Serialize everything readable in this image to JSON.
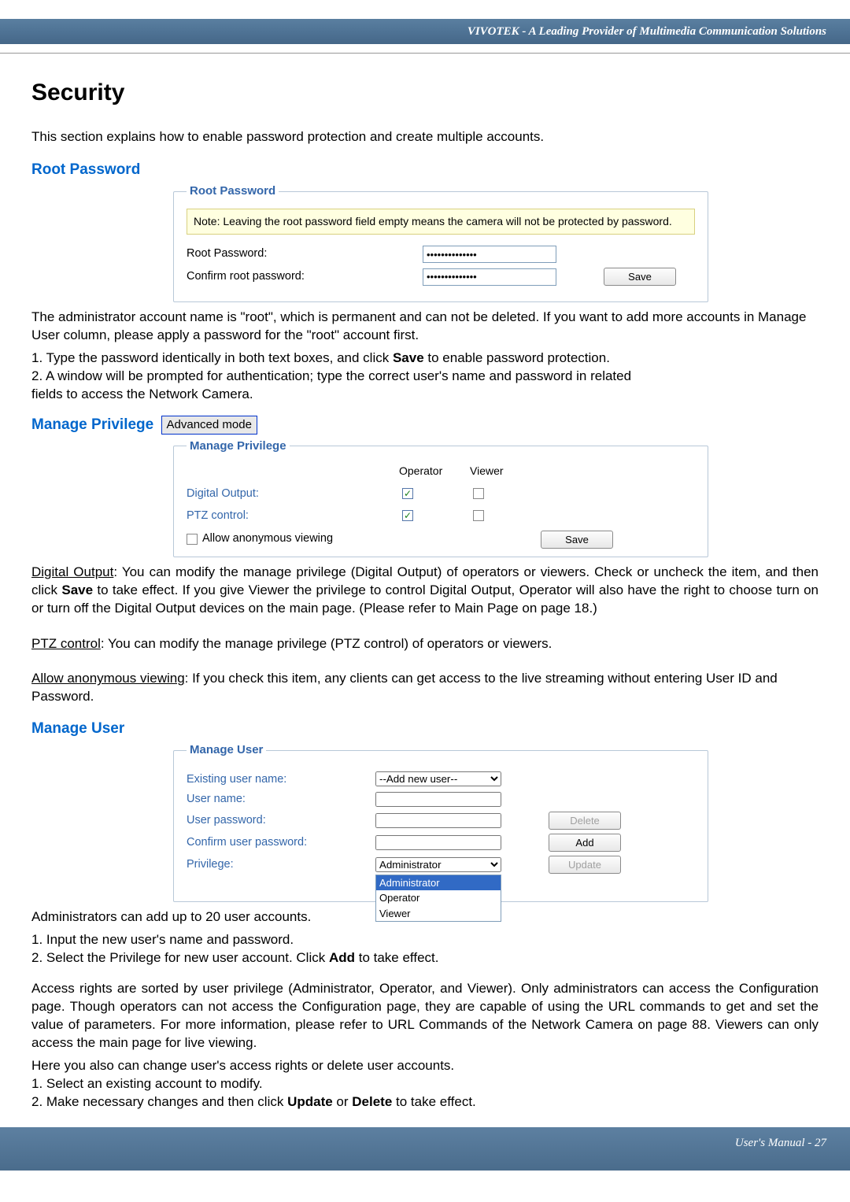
{
  "header": {
    "title": "VIVOTEK - A Leading Provider of Multimedia Communication Solutions"
  },
  "page_title": "Security",
  "intro": "This section explains how to enable password protection and create multiple accounts.",
  "root_pw": {
    "section_title": "Root Password",
    "legend": "Root Password",
    "note": "Note: Leaving the root password field empty means the camera will not be protected by password.",
    "row1_label": "Root Password:",
    "row1_value": "••••••••••••••",
    "row2_label": "Confirm root password:",
    "row2_value": "••••••••••••••",
    "save_label": "Save",
    "explain": [
      "The administrator account name is \"root\", which is permanent and can not be deleted. If you want to add more accounts in Manage User column, please apply a password for the \"root\" account first.",
      "1. Type the password identically in both text boxes, and click Save to enable password protection.",
      "2. A window will be prompted for authentication; type the correct user's name and password in related",
      "    fields to access the Network Camera."
    ]
  },
  "priv": {
    "section_title": "Manage Privilege",
    "badge": "Advanced mode",
    "legend": "Manage Privilege",
    "col_operator": "Operator",
    "col_viewer": "Viewer",
    "row1_label": "Digital Output:",
    "row2_label": "PTZ control:",
    "anon_label": "Allow anonymous viewing",
    "save_label": "Save",
    "p_digital": "Digital Output: You can modify the manage privilege (Digital Output) of operators or viewers. Check or uncheck the item, and then click Save to take effect. If you give Viewer the privilege to control Digital Output, Operator will also have the right to choose turn on or turn off the Digital Output devices on the main page. (Please refer to Main Page on page 18.)",
    "p_digital_underline": "Digital Output",
    "p_ptz": "PTZ control: You can modify the manage privilege (PTZ control) of operators or viewers.",
    "p_ptz_underline": "PTZ control",
    "p_anon": "Allow anonymous viewing: If you check this item, any clients can get access to the live streaming without entering User ID and Password.",
    "p_anon_underline": "Allow anonymous viewing"
  },
  "mu": {
    "section_title": "Manage User",
    "legend": "Manage User",
    "existing_label": "Existing user name:",
    "existing_value": "--Add new user--",
    "username_label": "User name:",
    "userpw_label": "User password:",
    "confirmpw_label": "Confirm user password:",
    "privilege_label": "Privilege:",
    "privilege_value": "Administrator",
    "opt_admin": "Administrator",
    "opt_operator": "Operator",
    "opt_viewer": "Viewer",
    "delete_label": "Delete",
    "add_label": "Add",
    "update_label": "Update",
    "explain1": "Administrators can add up to 20 user accounts.",
    "explain2": "1. Input the new user's name and password.",
    "explain3": "2. Select the Privilege for new user account. Click Add to take effect.",
    "para2": "Access rights are sorted by user privilege (Administrator, Operator, and Viewer). Only administrators can access the Configuration page. Though operators can not access the Configuration page, they are capable of using the URL commands to get and set the value of parameters. For more information, please refer to URL Commands of the Network Camera on page 88. Viewers can only access the main page for live viewing.",
    "para3": "Here you also can change user's access rights or delete user accounts.",
    "para4": "1. Select an existing account to modify.",
    "para5": "2. Make necessary changes and then click Update or Delete to take effect."
  },
  "footer": {
    "text": "User's Manual - 27"
  }
}
